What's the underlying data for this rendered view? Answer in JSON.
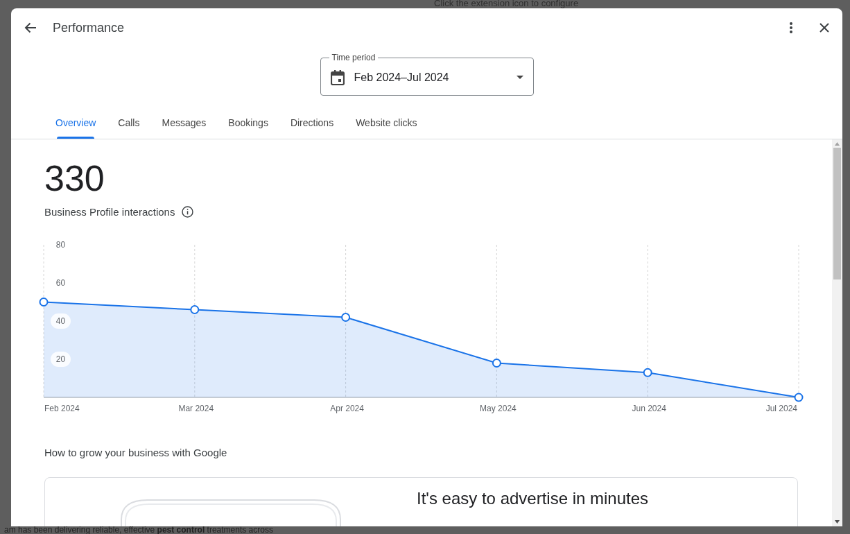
{
  "backdrop": {
    "extension_hint": "Click the extension icon to configure",
    "footer_text": "am has been delivering reliable, effective **pest control** treatments across"
  },
  "dialog": {
    "title": "Performance",
    "time_period": {
      "label": "Time period",
      "value": "Feb 2024–Jul 2024"
    },
    "tabs": [
      {
        "label": "Overview",
        "selected": true
      },
      {
        "label": "Calls",
        "selected": false
      },
      {
        "label": "Messages",
        "selected": false
      },
      {
        "label": "Bookings",
        "selected": false
      },
      {
        "label": "Directions",
        "selected": false
      },
      {
        "label": "Website clicks",
        "selected": false
      }
    ],
    "total": "330",
    "total_label": "Business Profile interactions",
    "chart_data": {
      "type": "area",
      "categories": [
        "Feb 2024",
        "Mar 2024",
        "Apr 2024",
        "May 2024",
        "Jun 2024",
        "Jul 2024"
      ],
      "series": [
        {
          "color": "#1a73e8",
          "values": [
            50,
            46,
            42,
            18,
            13,
            0
          ]
        }
      ],
      "ylim": [
        0,
        80
      ],
      "yticks": [
        20,
        40,
        60,
        80
      ],
      "grid": true
    },
    "section_title": "How to grow your business with Google",
    "promo": {
      "headline": "It's easy to advertise in minutes"
    }
  }
}
